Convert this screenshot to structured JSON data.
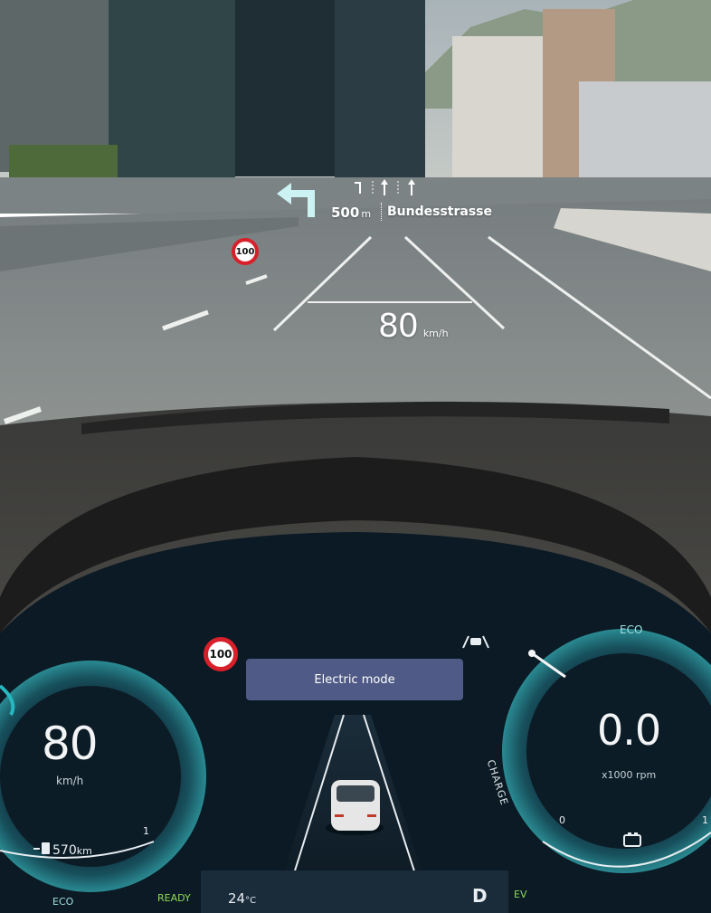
{
  "colors": {
    "hud_text": "#ffffff",
    "cluster_bg": "#0b1a24",
    "gauge_teal": "#1a6a74",
    "accent_green": "#8fd85a",
    "accent_cyan": "#9fe0df",
    "sign_red": "#d8202a",
    "mode_banner": "#4f5b86"
  },
  "hud": {
    "distance_value": "500",
    "distance_unit": "m",
    "street": "Bundesstrasse",
    "speed_value": "80",
    "speed_unit": "km/h",
    "speed_limit": "100",
    "turn_icon": "turn-left-arrow-icon",
    "lane_icons": [
      "lane-turn-left-icon",
      "lane-straight-icon",
      "lane-straight-icon"
    ]
  },
  "cluster": {
    "speed_limit": "100",
    "mode": "Electric mode",
    "speed": {
      "value": "80",
      "unit": "km/h"
    },
    "range": {
      "value": "570",
      "unit": "km",
      "icon": "fuel-pump-icon"
    },
    "left_gauge_tick": "1",
    "left_mode": "ECO",
    "status": "READY",
    "temperature": {
      "value": "24",
      "unit": "°C"
    },
    "gear": "D",
    "drive_mode": "EV",
    "rpm": {
      "value": "0.0",
      "unit": "x1000 rpm",
      "eco_label": "ECO",
      "charge_label": "CHARGE",
      "tick_min": "0",
      "tick_max": "1"
    },
    "icons": [
      "lane-assist-icon",
      "battery-icon",
      "car-icon"
    ]
  }
}
